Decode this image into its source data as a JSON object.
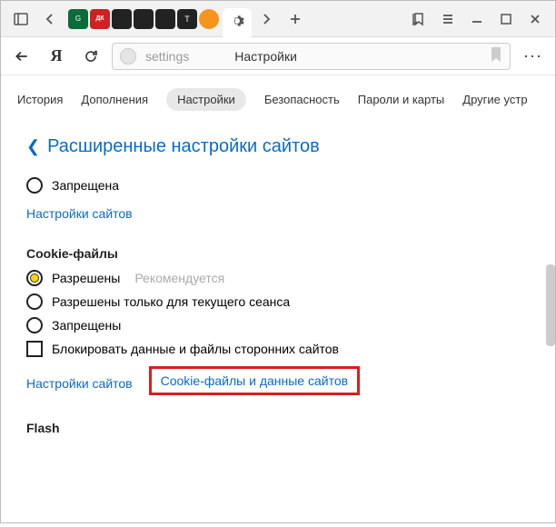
{
  "address": {
    "path": "settings",
    "title": "Настройки"
  },
  "navtabs": [
    "История",
    "Дополнения",
    "Настройки",
    "Безопасность",
    "Пароли и карты",
    "Другие устр"
  ],
  "navtabs_active_index": 2,
  "back_link": "Расширенные настройки сайтов",
  "top_radio": "Запрещена",
  "site_settings_link": "Настройки сайтов",
  "cookies": {
    "title": "Cookie-файлы",
    "opt_allowed": "Разрешены",
    "recommended": "Рекомендуется",
    "opt_session": "Разрешены только для текущего сеанса",
    "opt_blocked": "Запрещены",
    "block_third_party": "Блокировать данные и файлы сторонних сайтов",
    "cookie_data_link": "Cookie-файлы и данные сайтов"
  },
  "flash_title": "Flash"
}
